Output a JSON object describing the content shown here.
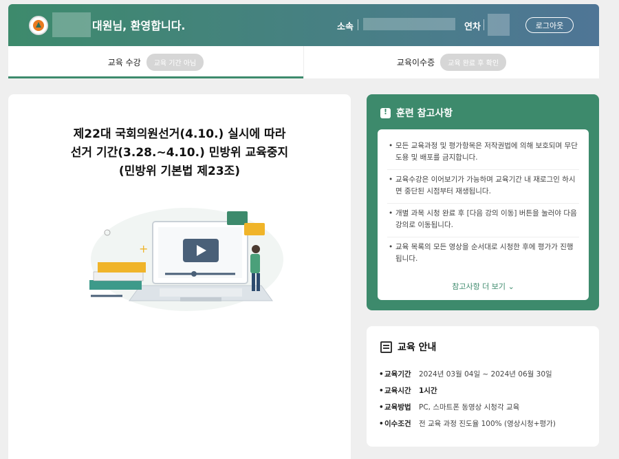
{
  "header": {
    "welcome": "대원님, 환영합니다.",
    "org_label": "소속",
    "year_label": "연차",
    "logout_label": "로그아웃"
  },
  "tabs": [
    {
      "label": "교육 수강",
      "badge": "교육 기간 아님"
    },
    {
      "label": "교육이수증",
      "badge": "교육 완료 후 확인"
    }
  ],
  "notice": {
    "line1": "제22대 국회의원선거(4.10.) 실시에 따라",
    "line2": "선거 기간(3.28.~4.10.) 민방위 교육중지",
    "line3": "(민방위 기본법 제23조)"
  },
  "reference": {
    "title": "훈련 참고사항",
    "items": [
      "모든 교육과정 및 평가항목은 저작권법에 의해 보호되며 무단 도용 및 배포를 금지합니다.",
      "교육수강은 이어보기가 가능하며 교육기간 내 재로그인 하시면 중단된 시점부터 재생됩니다.",
      "개별 과목 시청 완료 후 [다음 강의 이동] 버튼을 눌러야 다음 강의로 이동됩니다.",
      "교육 목록의 모든 영상을 순서대로 시청한 후에 평가가 진행됩니다."
    ],
    "more_label": "참고사항 더 보기"
  },
  "education": {
    "title": "교육 안내",
    "rows": [
      {
        "key": "교육기간",
        "value": "2024년 03월 04일 ~ 2024년 06월 30일"
      },
      {
        "key": "교육시간",
        "value": "1시간"
      },
      {
        "key": "교육방법",
        "value": "PC, 스마트폰 동영상 시청각 교육"
      },
      {
        "key": "이수조건",
        "value": "전 교육 과정 진도율 100% (영상시청+평가)"
      }
    ]
  },
  "colors": {
    "primary": "#3d8a6c",
    "header_end": "#4f7596",
    "pill": "#d6d6d6"
  },
  "icons": {
    "logo": "civil-defense-logo",
    "reference": "alert-speech-icon",
    "education": "book-icon",
    "more": "chevron-down-icon"
  }
}
